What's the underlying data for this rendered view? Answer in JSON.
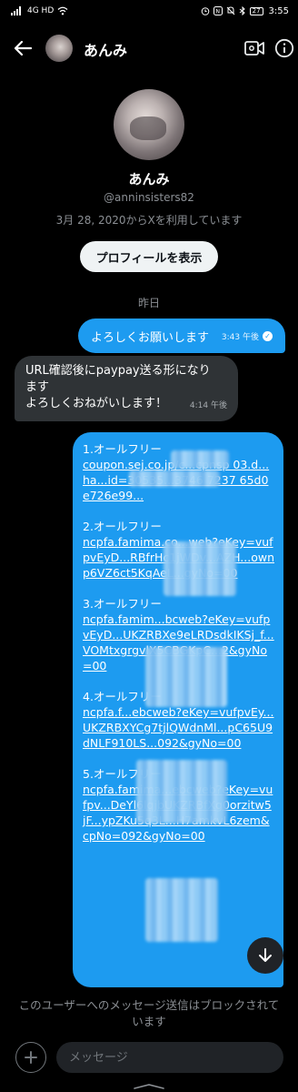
{
  "status_bar": {
    "left_text": "4G HD",
    "battery": "27",
    "time": "3:55"
  },
  "header": {
    "name": "あんみ",
    "icons": [
      "back-arrow-icon",
      "video-icon",
      "info-icon"
    ]
  },
  "profile": {
    "name": "あんみ",
    "handle": "@anninsisters82",
    "joined": "3月 28, 2020からXを利用しています",
    "button_label": "プロフィールを表示"
  },
  "date_separator": "昨日",
  "messages": {
    "m1": {
      "text": "よろしくお願いします",
      "time": "3:43 午後"
    },
    "m2": {
      "lines": [
        "URL確認後にpaypay送る形になり",
        "ます",
        "よろしくおねがいします！"
      ],
      "time": "4:14 午後"
    },
    "m3": {
      "items": [
        {
          "head": "1.オールフリー",
          "link": "coupon.sej.co.jp/c...cpnsp 03.d... ha...id=30535...3746 7237 65d0e726e99..."
        },
        {
          "head": "2.オールフリー",
          "link": "ncpfa.famima.co...web?eKey=vufpvEyD...RBfrHc1jWDv...AZH...ownp6VZ6ct5KqAeL...gyNo=00"
        },
        {
          "head": "3.オールフリー",
          "link": "ncpfa.famim...bcweb?eKey=vufpvEyD...UKZRBXe9eLRDsdkIKSj_f...VOMtxgrgvlX5CBGKpC...2&gyNo=00"
        },
        {
          "head": "4.オールフリー",
          "link": "ncpfa.f...ebcweb?eKey=vufpvEy...UKZRBXYCg7tjlQWdnMl...pC65U9dNLF910LS...092&gyNo=00"
        },
        {
          "head": "5.オールフリー",
          "link": "ncpfa.famima...ebcweb?eKey=vufpv...DeYl6lqjbUKZRBfXg0orzitw5jF...ypZKu5q3L...H7amkvL6zem&cpNo=092&gyNo=00"
        }
      ]
    }
  },
  "blocked_notice": "このユーザーへのメッセージ送信はブロックされています",
  "composer": {
    "placeholder": "メッセージ"
  }
}
